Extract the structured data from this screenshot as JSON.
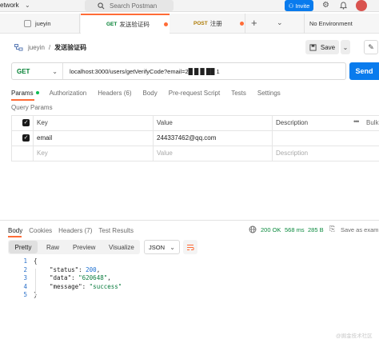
{
  "topbar": {
    "workspace_label": "etwork",
    "search_placeholder": "Search Postman",
    "invite_label": "Invite"
  },
  "tabs": {
    "user_tab_label": "jueyin",
    "items": [
      {
        "method": "GET",
        "name": "发送验证码",
        "method_color": "#007f31",
        "active": true
      },
      {
        "method": "POST",
        "name": "注册",
        "method_color": "#ad7a03",
        "active": false
      }
    ],
    "environment": "No Environment"
  },
  "breadcrumb": {
    "workspace": "jueyin",
    "separator": "/",
    "request": "发送验证码"
  },
  "save_label": "Save",
  "request": {
    "method": "GET",
    "url": "localhost:3000/users/getVerifyCode?email=2█ █  █    ██    1",
    "send_label": "Send"
  },
  "request_tabs": [
    {
      "label": "Params",
      "active": true,
      "dot": true
    },
    {
      "label": "Authorization"
    },
    {
      "label": "Headers (6)"
    },
    {
      "label": "Body"
    },
    {
      "label": "Pre-request Script"
    },
    {
      "label": "Tests"
    },
    {
      "label": "Settings"
    }
  ],
  "query_params": {
    "title": "Query Params",
    "columns": {
      "key": "Key",
      "value": "Value",
      "description": "Description",
      "bulk": "Bulk"
    },
    "rows": [
      {
        "key": "email",
        "value": "244337462@qq.com",
        "description": ""
      }
    ],
    "placeholder": {
      "key": "Key",
      "value": "Value",
      "description": "Description"
    }
  },
  "response_tabs": [
    {
      "label": "Body",
      "active": true
    },
    {
      "label": "Cookies"
    },
    {
      "label": "Headers (7)"
    },
    {
      "label": "Test Results"
    }
  ],
  "response_meta": {
    "status": "200 OK",
    "time": "568 ms",
    "size": "285 B",
    "save_as": "Save as examp"
  },
  "view_modes": {
    "pretty": "Pretty",
    "raw": "Raw",
    "preview": "Preview",
    "visualize": "Visualize",
    "format": "JSON"
  },
  "code_lines": [
    {
      "n": "1",
      "text": "{"
    },
    {
      "n": "2",
      "key": "\"status\"",
      "value": "200",
      "type": "number"
    },
    {
      "n": "3",
      "key": "\"data\"",
      "value": "\"620648\"",
      "type": "string"
    },
    {
      "n": "4",
      "key": "\"message\"",
      "value": "\"success\"",
      "type": "string"
    },
    {
      "n": "5",
      "text": "}"
    }
  ],
  "watermark": "@掘金技术社区"
}
